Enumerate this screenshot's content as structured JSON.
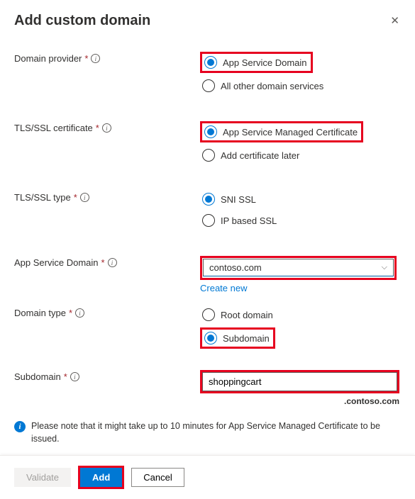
{
  "title": "Add custom domain",
  "fields": {
    "domain_provider": {
      "label": "Domain provider",
      "options": {
        "app_service": "App Service Domain",
        "other": "All other domain services"
      }
    },
    "tls_cert": {
      "label": "TLS/SSL certificate",
      "options": {
        "managed": "App Service Managed Certificate",
        "later": "Add certificate later"
      }
    },
    "tls_type": {
      "label": "TLS/SSL type",
      "options": {
        "sni": "SNI SSL",
        "ip": "IP based SSL"
      }
    },
    "app_domain": {
      "label": "App Service Domain",
      "value": "contoso.com",
      "create_new": "Create new"
    },
    "domain_type": {
      "label": "Domain type",
      "options": {
        "root": "Root domain",
        "sub": "Subdomain"
      }
    },
    "subdomain": {
      "label": "Subdomain",
      "value": "shoppingcart",
      "suffix": ".contoso.com"
    }
  },
  "note": "Please note that it might take up to 10 minutes for App Service Managed Certificate to be issued.",
  "buttons": {
    "validate": "Validate",
    "add": "Add",
    "cancel": "Cancel"
  }
}
